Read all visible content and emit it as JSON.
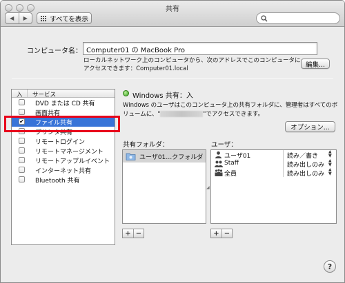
{
  "window": {
    "title": "共有"
  },
  "toolbar": {
    "back_label": "◀",
    "forward_label": "▶",
    "show_all_label": "すべてを表示",
    "search_placeholder": ""
  },
  "computer_name": {
    "label": "コンピュータ名：",
    "value": "Computer01 の MacBook Pro",
    "description": "ローカルネットワーク上のコンピュータから、次のアドレスでこのコンピュータにアクセスできます：Computer01.local",
    "edit_label": "編集..."
  },
  "services": {
    "header_on": "入",
    "header_service": "サービス",
    "items": [
      {
        "label": "DVD または CD 共有",
        "checked": false
      },
      {
        "label": "画面共有",
        "checked": false
      },
      {
        "label": "ファイル共有",
        "checked": true
      },
      {
        "label": "プリンタ共有",
        "checked": false
      },
      {
        "label": "リモートログイン",
        "checked": false
      },
      {
        "label": "リモートマネージメント",
        "checked": false
      },
      {
        "label": "リモートアップルイベント",
        "checked": false
      },
      {
        "label": "インターネット共有",
        "checked": false
      },
      {
        "label": "Bluetooth 共有",
        "checked": false
      }
    ]
  },
  "file_sharing": {
    "status": "Windows 共有：入",
    "desc_before": "Windows のユーザはこのコンピュータ上の共有フォルダに、管理者はすべてのボリュームに、\"",
    "desc_after": "\"でアクセスできます。",
    "options_label": "オプション...",
    "shared_folders_label": "共有フォルダ：",
    "users_label": "ユーザ：",
    "folders": [
      {
        "name": "ユーザ01…クフォルダ"
      }
    ],
    "users": [
      {
        "name": "ユーザ01",
        "permission": "読み／書き",
        "icon": "single-user-icon"
      },
      {
        "name": "Staff",
        "permission": "読み出しのみ",
        "icon": "group-icon"
      },
      {
        "name": "全員",
        "permission": "読み出しのみ",
        "icon": "everyone-icon"
      }
    ],
    "add_label": "+",
    "remove_label": "−"
  },
  "help_label": "?",
  "colors": {
    "selection": "#3874d8",
    "highlight_box": "#e8001a",
    "status_on": "#3aa21e"
  }
}
